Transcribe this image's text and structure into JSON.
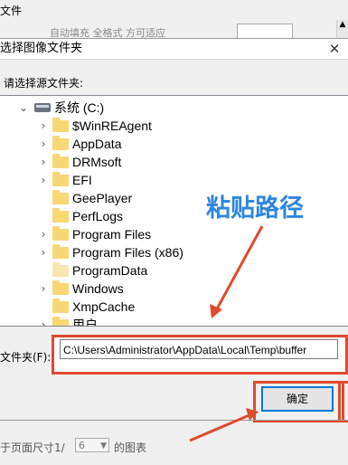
{
  "background": {
    "tab_label": "文件",
    "ghost_text": "自动填充        全格式        方可适应",
    "scroll_glyph": "▲"
  },
  "dialog": {
    "title": "选择图像文件夹",
    "close_glyph": "✕",
    "prompt": "请选择源文件夹:",
    "tree": {
      "root": {
        "label": "系统 (C:)",
        "expanded": true
      },
      "items": [
        {
          "label": "$WinREAgent",
          "expandable": true,
          "pale": false
        },
        {
          "label": "AppData",
          "expandable": true,
          "pale": false
        },
        {
          "label": "DRMsoft",
          "expandable": true,
          "pale": false
        },
        {
          "label": "EFI",
          "expandable": true,
          "pale": false
        },
        {
          "label": "GeePlayer",
          "expandable": false,
          "pale": false
        },
        {
          "label": "PerfLogs",
          "expandable": false,
          "pale": false
        },
        {
          "label": "Program Files",
          "expandable": true,
          "pale": false
        },
        {
          "label": "Program Files (x86)",
          "expandable": true,
          "pale": false
        },
        {
          "label": "ProgramData",
          "expandable": false,
          "pale": true
        },
        {
          "label": "Windows",
          "expandable": true,
          "pale": false
        },
        {
          "label": "XmpCache",
          "expandable": false,
          "pale": false
        },
        {
          "label": "用户",
          "expandable": true,
          "pale": false
        }
      ]
    },
    "folder_field": {
      "label": "文件夹(F):",
      "value": "C:\\Users\\Administrator\\AppData\\Local\\Temp\\buffer"
    },
    "ok_label": "确定"
  },
  "annotation": {
    "text": "粘贴路径",
    "color": "#2e86de",
    "arrow_color": "#e04a2f"
  },
  "bottom": {
    "prefix": "于页面尺寸1/",
    "select_value": "6",
    "suffix": "的图表"
  }
}
